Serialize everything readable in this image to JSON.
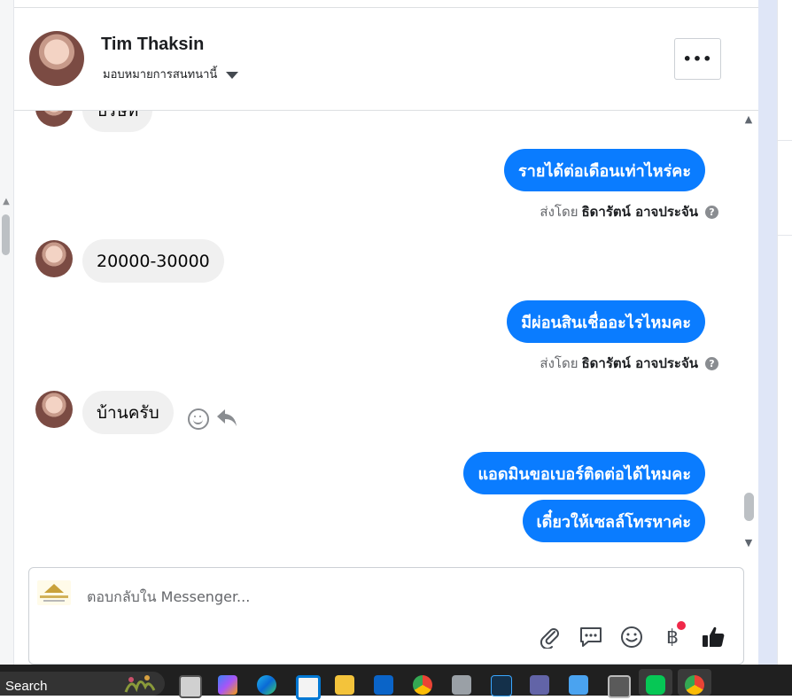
{
  "contact": {
    "name": "Tim Thaksin",
    "assign_label": "มอบหมายการสนทนานี้"
  },
  "header": {
    "more_label": "•••"
  },
  "messages": [
    {
      "dir": "in",
      "text": "บริษัท"
    },
    {
      "dir": "out",
      "text": "รายได้ต่อเดือนเท่าไหร่คะ"
    },
    {
      "dir": "meta",
      "prefix": "ส่งโดย",
      "sender": "ธิดารัตน์ อาจประจัน"
    },
    {
      "dir": "in",
      "text": "20000-30000"
    },
    {
      "dir": "out",
      "text": "มีผ่อนสินเชื่ออะไรไหมคะ"
    },
    {
      "dir": "meta",
      "prefix": "ส่งโดย",
      "sender": "ธิดารัตน์ อาจประจัน"
    },
    {
      "dir": "in",
      "text": "บ้านครับ"
    },
    {
      "dir": "out",
      "text": "แอดมินขอเบอร์ติดต่อได้ไหมคะ"
    },
    {
      "dir": "out",
      "text": "เดี๋ยวให้เซลล์โทรหาค่ะ"
    }
  ],
  "composer": {
    "placeholder": "ตอบกลับใน Messenger..."
  },
  "composer_icons": [
    "paperclip-icon",
    "chat-bubble-icon",
    "emoji-icon",
    "baht-icon",
    "thumbs-up-icon"
  ],
  "composer_symbols": {
    "baht": "฿"
  },
  "taskbar": {
    "search_label": "Search",
    "apps": [
      "task-view",
      "copilot",
      "edge",
      "store",
      "file-explorer",
      "outlook",
      "chrome",
      "camera",
      "waves-app",
      "teams",
      "notepad",
      "calculator",
      "line",
      "chrome-profile"
    ]
  },
  "colors": {
    "outgoing_bubble": "#0a7cff",
    "incoming_bubble": "#f0f0f0",
    "taskbar": "#202020",
    "line_green": "#06c755"
  }
}
